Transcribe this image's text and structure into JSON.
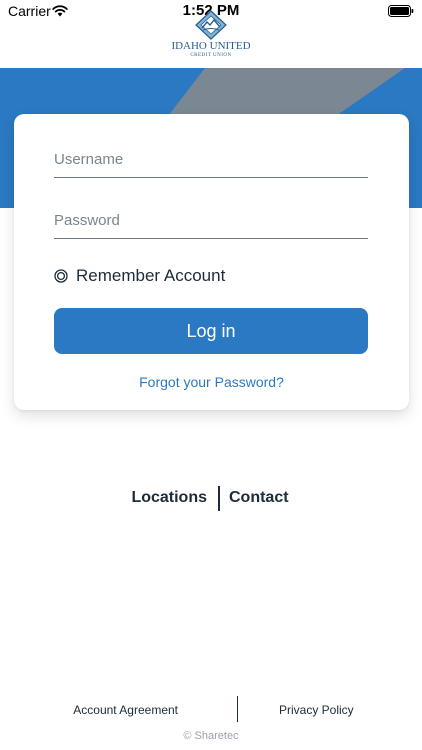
{
  "status_bar": {
    "carrier": "Carrier",
    "time": "1:52 PM",
    "icons": [
      "wifi-icon",
      "battery-icon"
    ]
  },
  "brand": {
    "name": "IDAHO UNITED",
    "subtitle": "CREDIT UNION",
    "colors": {
      "primary": "#2b79c2",
      "banner_gray": "#7b8894",
      "text": "#1d2b3a"
    }
  },
  "login": {
    "username_placeholder": "Username",
    "password_placeholder": "Password",
    "remember_label": "Remember Account",
    "remember_checked": false,
    "login_button": "Log in",
    "forgot_link": "Forgot your Password?"
  },
  "quick_links": {
    "locations": "Locations",
    "contact": "Contact"
  },
  "footer": {
    "account_agreement": "Account Agreement",
    "privacy_policy": "Privacy Policy",
    "copyright": "© Sharetec"
  }
}
